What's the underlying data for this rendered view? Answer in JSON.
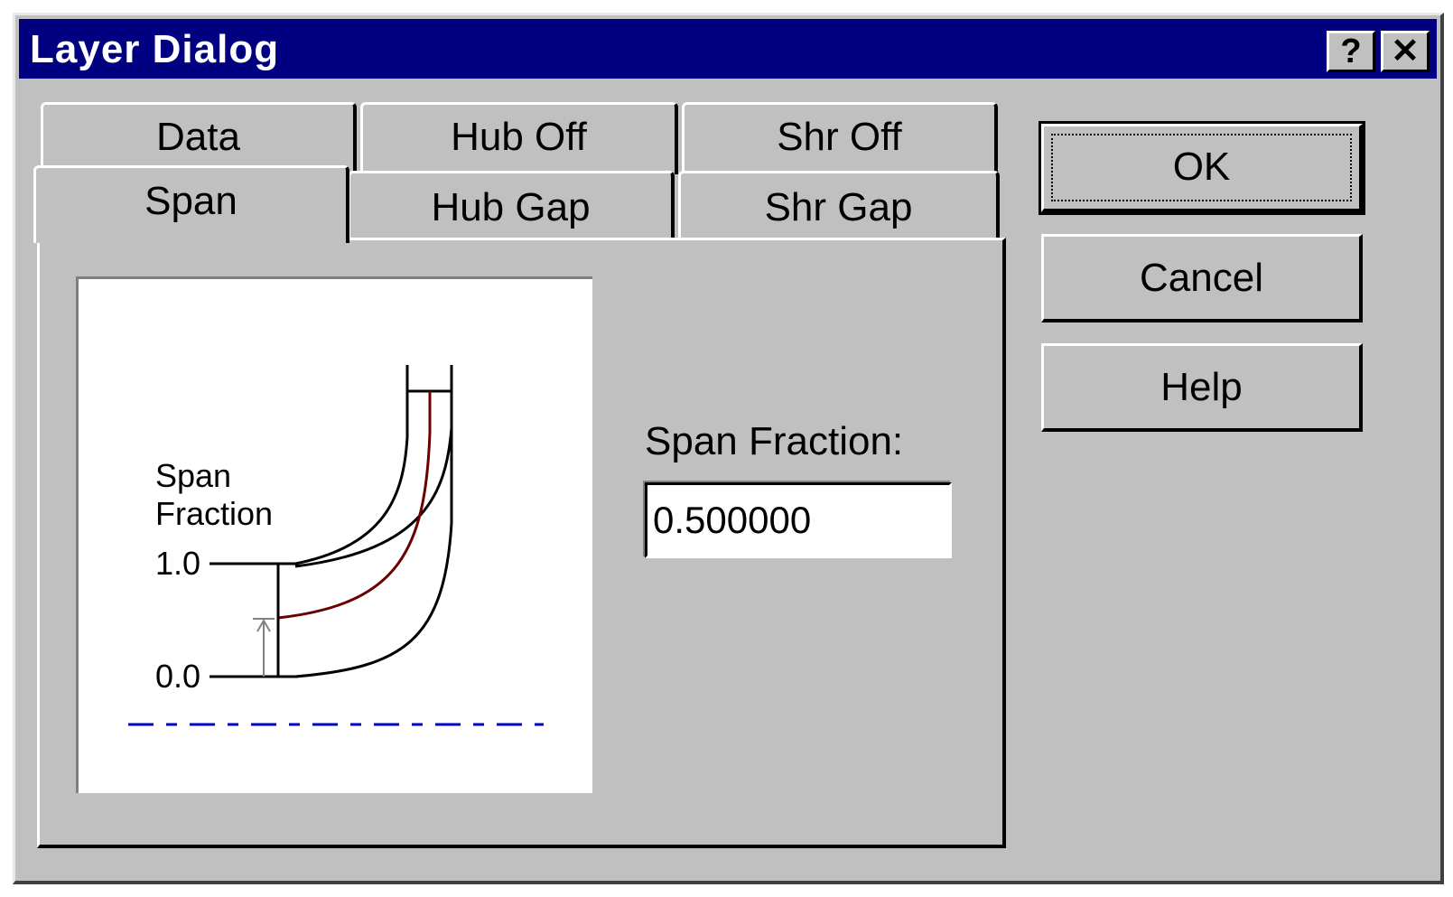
{
  "window": {
    "title": "Layer Dialog",
    "help_glyph": "?",
    "close_glyph": "✕"
  },
  "tabs": {
    "row_back": [
      "Data",
      "Hub Off",
      "Shr Off"
    ],
    "row_front": [
      "Span",
      "Hub Gap",
      "Shr Gap"
    ],
    "active": "Span"
  },
  "diagram": {
    "label_line1": "Span",
    "label_line2": "Fraction",
    "tick_top": "1.0",
    "tick_bottom": "0.0"
  },
  "span_fraction": {
    "label": "Span Fraction:",
    "value": "0.500000"
  },
  "buttons": {
    "ok": "OK",
    "cancel": "Cancel",
    "help": "Help"
  },
  "colors": {
    "title_bar": "#000080",
    "face": "#c0c0c0",
    "midline": "#6b0000",
    "axis_dash": "#0000c0"
  }
}
